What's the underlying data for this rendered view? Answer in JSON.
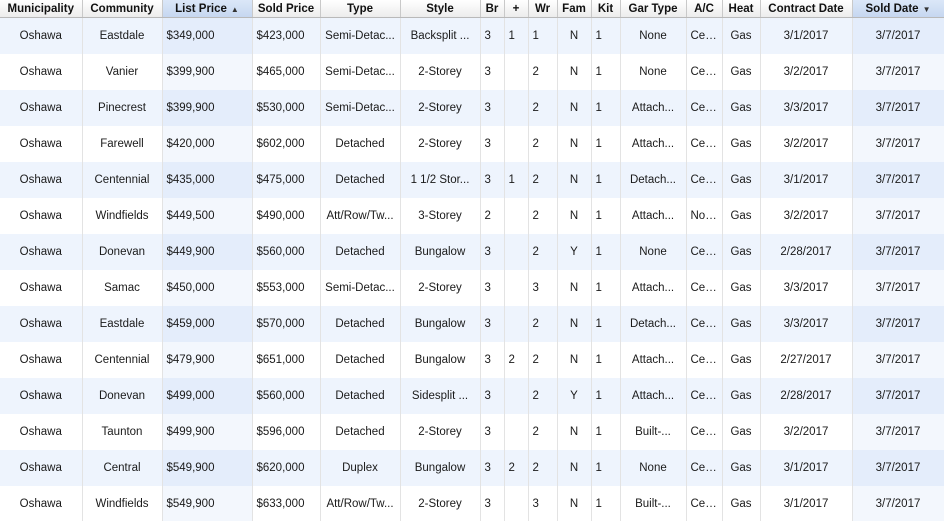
{
  "columns": [
    {
      "key": "municipality",
      "label": "Municipality",
      "width": 82,
      "align": "center",
      "sort": ""
    },
    {
      "key": "community",
      "label": "Community",
      "width": 80,
      "align": "center",
      "sort": ""
    },
    {
      "key": "list_price",
      "label": "List Price",
      "width": 90,
      "align": "left",
      "sort": "asc"
    },
    {
      "key": "sold_price",
      "label": "Sold Price",
      "width": 68,
      "align": "left",
      "sort": ""
    },
    {
      "key": "type",
      "label": "Type",
      "width": 80,
      "align": "center",
      "sort": ""
    },
    {
      "key": "style",
      "label": "Style",
      "width": 80,
      "align": "center",
      "sort": ""
    },
    {
      "key": "br",
      "label": "Br",
      "width": 24,
      "align": "left",
      "sort": ""
    },
    {
      "key": "plus",
      "label": "+",
      "width": 24,
      "align": "left",
      "sort": ""
    },
    {
      "key": "wr",
      "label": "Wr",
      "width": 29,
      "align": "left",
      "sort": ""
    },
    {
      "key": "fam",
      "label": "Fam",
      "width": 34,
      "align": "center",
      "sort": ""
    },
    {
      "key": "kit",
      "label": "Kit",
      "width": 29,
      "align": "left",
      "sort": ""
    },
    {
      "key": "gar_type",
      "label": "Gar Type",
      "width": 66,
      "align": "center",
      "sort": ""
    },
    {
      "key": "ac",
      "label": "A/C",
      "width": 36,
      "align": "left",
      "sort": ""
    },
    {
      "key": "heat",
      "label": "Heat",
      "width": 38,
      "align": "center",
      "sort": ""
    },
    {
      "key": "contract_date",
      "label": "Contract Date",
      "width": 92,
      "align": "center",
      "sort": ""
    },
    {
      "key": "sold_date",
      "label": "Sold Date",
      "width": 92,
      "align": "center",
      "sort": "desc"
    }
  ],
  "rows": [
    [
      "Oshawa",
      "Eastdale",
      "$349,000",
      "$423,000",
      "Semi-Detac...",
      "Backsplit ...",
      "3",
      "1",
      "1",
      "N",
      "1",
      "None",
      "Cen...",
      "Gas",
      "3/1/2017",
      "3/7/2017"
    ],
    [
      "Oshawa",
      "Vanier",
      "$399,900",
      "$465,000",
      "Semi-Detac...",
      "2-Storey",
      "3",
      "",
      "2",
      "N",
      "1",
      "None",
      "Cen...",
      "Gas",
      "3/2/2017",
      "3/7/2017"
    ],
    [
      "Oshawa",
      "Pinecrest",
      "$399,900",
      "$530,000",
      "Semi-Detac...",
      "2-Storey",
      "3",
      "",
      "2",
      "N",
      "1",
      "Attach...",
      "Cen...",
      "Gas",
      "3/3/2017",
      "3/7/2017"
    ],
    [
      "Oshawa",
      "Farewell",
      "$420,000",
      "$602,000",
      "Detached",
      "2-Storey",
      "3",
      "",
      "2",
      "N",
      "1",
      "Attach...",
      "Cen...",
      "Gas",
      "3/2/2017",
      "3/7/2017"
    ],
    [
      "Oshawa",
      "Centennial",
      "$435,000",
      "$475,000",
      "Detached",
      "1 1/2 Stor...",
      "3",
      "1",
      "2",
      "N",
      "1",
      "Detach...",
      "Cen...",
      "Gas",
      "3/1/2017",
      "3/7/2017"
    ],
    [
      "Oshawa",
      "Windfields",
      "$449,500",
      "$490,000",
      "Att/Row/Tw...",
      "3-Storey",
      "2",
      "",
      "2",
      "N",
      "1",
      "Attach...",
      "Non...",
      "Gas",
      "3/2/2017",
      "3/7/2017"
    ],
    [
      "Oshawa",
      "Donevan",
      "$449,900",
      "$560,000",
      "Detached",
      "Bungalow",
      "3",
      "",
      "2",
      "Y",
      "1",
      "None",
      "Cen...",
      "Gas",
      "2/28/2017",
      "3/7/2017"
    ],
    [
      "Oshawa",
      "Samac",
      "$450,000",
      "$553,000",
      "Semi-Detac...",
      "2-Storey",
      "3",
      "",
      "3",
      "N",
      "1",
      "Attach...",
      "Cen...",
      "Gas",
      "3/3/2017",
      "3/7/2017"
    ],
    [
      "Oshawa",
      "Eastdale",
      "$459,000",
      "$570,000",
      "Detached",
      "Bungalow",
      "3",
      "",
      "2",
      "N",
      "1",
      "Detach...",
      "Cen...",
      "Gas",
      "3/3/2017",
      "3/7/2017"
    ],
    [
      "Oshawa",
      "Centennial",
      "$479,900",
      "$651,000",
      "Detached",
      "Bungalow",
      "3",
      "2",
      "2",
      "N",
      "1",
      "Attach...",
      "Cen...",
      "Gas",
      "2/27/2017",
      "3/7/2017"
    ],
    [
      "Oshawa",
      "Donevan",
      "$499,000",
      "$560,000",
      "Detached",
      "Sidesplit ...",
      "3",
      "",
      "2",
      "Y",
      "1",
      "Attach...",
      "Cen...",
      "Gas",
      "2/28/2017",
      "3/7/2017"
    ],
    [
      "Oshawa",
      "Taunton",
      "$499,900",
      "$596,000",
      "Detached",
      "2-Storey",
      "3",
      "",
      "2",
      "N",
      "1",
      "Built-...",
      "Cen...",
      "Gas",
      "3/2/2017",
      "3/7/2017"
    ],
    [
      "Oshawa",
      "Central",
      "$549,900",
      "$620,000",
      "Duplex",
      "Bungalow",
      "3",
      "2",
      "2",
      "N",
      "1",
      "None",
      "Cen...",
      "Gas",
      "3/1/2017",
      "3/7/2017"
    ],
    [
      "Oshawa",
      "Windfields",
      "$549,900",
      "$633,000",
      "Att/Row/Tw...",
      "2-Storey",
      "3",
      "",
      "3",
      "N",
      "1",
      "Built-...",
      "Cen...",
      "Gas",
      "3/1/2017",
      "3/7/2017"
    ]
  ],
  "sort_icons": {
    "asc": "▲",
    "desc": "▼"
  }
}
